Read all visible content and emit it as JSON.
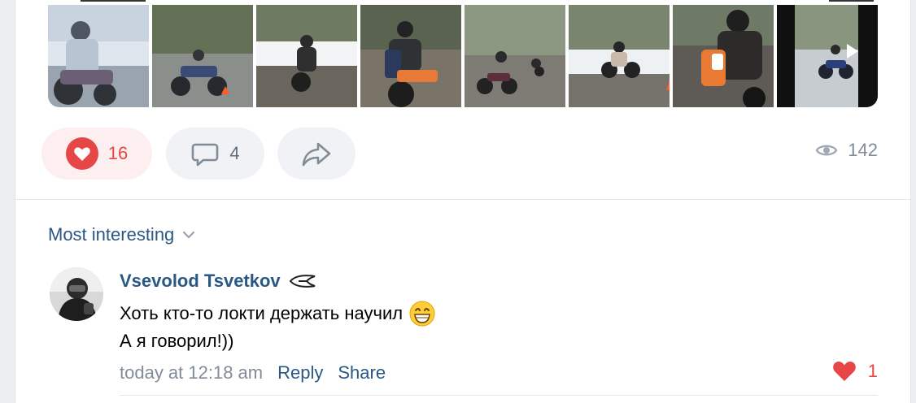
{
  "post": {
    "photos": [
      {
        "name": "rider-snow-closeup",
        "colors": [
          "#a9b7c6",
          "#4d5a66",
          "#e9edf1"
        ]
      },
      {
        "name": "rider-on-track",
        "colors": [
          "#7f8b76",
          "#6b6f6d",
          "#d9dfe4"
        ]
      },
      {
        "name": "rider-mud",
        "colors": [
          "#6c6a62",
          "#9a9a92",
          "#e0e4e8"
        ]
      },
      {
        "name": "rider-leaning",
        "colors": [
          "#807c72",
          "#57534d",
          "#cfd4d8"
        ]
      },
      {
        "name": "riders-lot",
        "colors": [
          "#8c8f85",
          "#7c7a72",
          "#e4e8ec"
        ]
      },
      {
        "name": "rider-cones",
        "colors": [
          "#7d7f78",
          "#6f6d66",
          "#dde2e6"
        ]
      },
      {
        "name": "rider-closeup-orange",
        "colors": [
          "#5a5652",
          "#3f3b37",
          "#cfd3d6"
        ]
      },
      {
        "name": "video-clip",
        "colors": [
          "#9aa090",
          "#6f746c",
          "#e6ebef"
        ]
      }
    ],
    "likes_count": "16",
    "comments_count": "4",
    "views_count": "142",
    "accent_like": "#e64646"
  },
  "comments": {
    "sort_label": "Most interesting",
    "items": [
      {
        "author": "Vsevolod Tsvetkov",
        "text_line1": "Хоть кто-то локти держать научил",
        "emoji": "😁",
        "text_line2": "А я говорил!))",
        "time": "today at 12:18 am",
        "reply_label": "Reply",
        "share_label": "Share",
        "likes": "1"
      }
    ]
  },
  "icons": {
    "like": "heart-icon",
    "comment": "comment-bubble-icon",
    "share": "share-arrow-icon",
    "views": "eye-icon",
    "sort": "chevron-down-icon",
    "badge": "team-logo-icon",
    "play": "play-icon"
  }
}
